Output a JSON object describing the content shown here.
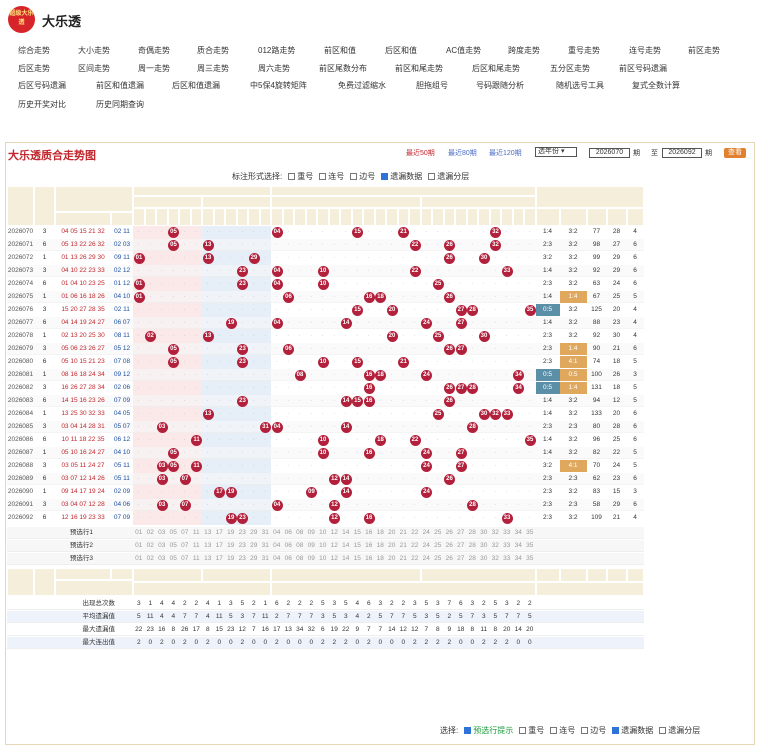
{
  "site": {
    "logo_text": "超级大乐透",
    "title": "大乐透"
  },
  "nav": [
    [
      "综合走势",
      "大小走势",
      "奇偶走势",
      "质合走势",
      "012路走势",
      "前区和值",
      "后区和值",
      "AC值走势",
      "跨度走势",
      "重号走势",
      "连号走势",
      "前区走势"
    ],
    [
      "后区走势",
      "区间走势",
      "周一走势",
      "周三走势",
      "周六走势",
      "前区尾数分布",
      "前区和尾走势",
      "后区和尾走势",
      "五分区走势",
      "前区号码遗漏"
    ],
    [
      "后区号码遗漏",
      "前区和值遗漏",
      "后区和值遗漏",
      "中5保4旋转矩阵",
      "免费过滤缩水",
      "胆拖组号",
      "号码跟随分析",
      "随机选号工具",
      "复式全数计算"
    ],
    [
      "历史开奖对比",
      "历史同期查询"
    ]
  ],
  "panel": {
    "title": "大乐透质合走势图",
    "recent": [
      "最近50期",
      "最近80期",
      "最近120期"
    ],
    "year_select": "选年份",
    "from": "2026070",
    "to": "2026092",
    "from_label": "期",
    "to_label": "至",
    "to_suffix": "期",
    "query_btn": "查看"
  },
  "options": {
    "label": "标注形式选择:",
    "items": [
      {
        "t": "重号",
        "on": false
      },
      {
        "t": "连号",
        "on": false
      },
      {
        "t": "边号",
        "on": false
      },
      {
        "t": "遗漏数据",
        "on": true
      },
      {
        "t": "遗漏分层",
        "on": false
      }
    ]
  },
  "headers": {
    "issue": "期号",
    "week": "星期",
    "draw": "开奖号码",
    "front": "前区",
    "back": "后区",
    "prime": "质数区",
    "prime_left": "质数左区",
    "prime_right": "质数右区",
    "comp": "合数区",
    "comp_left": "合数左区",
    "comp_right": "合数右区",
    "analysis": "前区分析",
    "an_cols": [
      "质合比",
      "奇偶比",
      "和值",
      "跨度",
      "AC值"
    ],
    "prime_nums": [
      "01",
      "02",
      "03",
      "05",
      "07",
      "11",
      "13",
      "17",
      "19",
      "23",
      "29",
      "31"
    ],
    "comp_nums": [
      "04",
      "06",
      "08",
      "09",
      "10",
      "12",
      "14",
      "15",
      "16",
      "18",
      "20",
      "21",
      "22",
      "24",
      "25",
      "26",
      "27",
      "28",
      "30",
      "32",
      "33",
      "34",
      "35"
    ]
  },
  "rows": [
    {
      "issue": "2026070",
      "week": "3",
      "f": "04 05 15 21 32",
      "b": "02 11",
      "balls": [
        "05",
        "04",
        "15",
        "21",
        "32"
      ],
      "qh": "1:4",
      "jo": "3:2",
      "sum": "77",
      "span": "28",
      "ac": "4"
    },
    {
      "issue": "2026071",
      "week": "6",
      "f": "05 13 22 26 32",
      "b": "02 03",
      "balls": [
        "05",
        "13",
        "22",
        "26",
        "32"
      ],
      "qh": "2:3",
      "jo": "3:2",
      "sum": "98",
      "span": "27",
      "ac": "6"
    },
    {
      "issue": "2026072",
      "week": "1",
      "f": "01 13 26 29 30",
      "b": "09 11",
      "balls": [
        "01",
        "13",
        "29",
        "26",
        "30"
      ],
      "qh": "3:2",
      "jo": "3:2",
      "sum": "99",
      "span": "29",
      "ac": "6"
    },
    {
      "issue": "2026073",
      "week": "3",
      "f": "04 10 22 23 33",
      "b": "02 12",
      "balls": [
        "23",
        "04",
        "10",
        "22",
        "33"
      ],
      "qh": "1:4",
      "jo": "3:2",
      "sum": "92",
      "span": "29",
      "ac": "6"
    },
    {
      "issue": "2026074",
      "week": "6",
      "f": "01 04 10 23 25",
      "b": "01 12",
      "balls": [
        "01",
        "23",
        "04",
        "10",
        "25"
      ],
      "qh": "2:3",
      "jo": "3:2",
      "sum": "63",
      "span": "24",
      "ac": "6"
    },
    {
      "issue": "2026075",
      "week": "1",
      "f": "01 06 16 18 26",
      "b": "04 10",
      "balls": [
        "01",
        "06",
        "16",
        "18",
        "26"
      ],
      "qh": "1:4",
      "jo": "1:4",
      "sum": "67",
      "span": "25",
      "ac": "5"
    },
    {
      "issue": "2026076",
      "week": "3",
      "f": "15 20 27 28 35",
      "b": "02 11",
      "balls": [
        "15",
        "20",
        "27",
        "28",
        "35"
      ],
      "qh": "0:5",
      "jo": "3:2",
      "sum": "125",
      "span": "20",
      "ac": "4"
    },
    {
      "issue": "2026077",
      "week": "6",
      "f": "04 14 19 24 27",
      "b": "06 07",
      "balls": [
        "19",
        "04",
        "14",
        "24",
        "27"
      ],
      "qh": "1:4",
      "jo": "3:2",
      "sum": "88",
      "span": "23",
      "ac": "4"
    },
    {
      "issue": "2026078",
      "week": "1",
      "f": "02 13 20 25 30",
      "b": "08 11",
      "balls": [
        "02",
        "13",
        "20",
        "25",
        "30"
      ],
      "qh": "2:3",
      "jo": "3:2",
      "sum": "92",
      "span": "30",
      "ac": "4"
    },
    {
      "issue": "2026079",
      "week": "3",
      "f": "05 06 23 26 27",
      "b": "05 12",
      "balls": [
        "05",
        "23",
        "06",
        "26",
        "27"
      ],
      "qh": "2:3",
      "jo": "1:4",
      "sum": "90",
      "span": "21",
      "ac": "6"
    },
    {
      "issue": "2026080",
      "week": "6",
      "f": "05 10 15 21 23",
      "b": "07 08",
      "balls": [
        "05",
        "23",
        "10",
        "15",
        "21"
      ],
      "qh": "2:3",
      "jo": "4:1",
      "sum": "74",
      "span": "18",
      "ac": "5"
    },
    {
      "issue": "2026081",
      "week": "1",
      "f": "08 16 18 24 34",
      "b": "09 12",
      "balls": [
        "08",
        "16",
        "18",
        "24",
        "34"
      ],
      "qh": "0:5",
      "jo": "0:5",
      "sum": "100",
      "span": "26",
      "ac": "3"
    },
    {
      "issue": "2026082",
      "week": "3",
      "f": "16 26 27 28 34",
      "b": "02 06",
      "balls": [
        "16",
        "26",
        "27",
        "28",
        "34"
      ],
      "qh": "0:5",
      "jo": "1:4",
      "sum": "131",
      "span": "18",
      "ac": "5"
    },
    {
      "issue": "2026083",
      "week": "6",
      "f": "14 15 16 23 26",
      "b": "07 09",
      "balls": [
        "23",
        "14",
        "15",
        "16",
        "26"
      ],
      "qh": "1:4",
      "jo": "3:2",
      "sum": "94",
      "span": "12",
      "ac": "5"
    },
    {
      "issue": "2026084",
      "week": "1",
      "f": "13 25 30 32 33",
      "b": "04 05",
      "balls": [
        "13",
        "25",
        "30",
        "32",
        "33"
      ],
      "qh": "1:4",
      "jo": "3:2",
      "sum": "133",
      "span": "20",
      "ac": "6"
    },
    {
      "issue": "2026085",
      "week": "3",
      "f": "03 04 14 28 31",
      "b": "05 07",
      "balls": [
        "03",
        "31",
        "04",
        "14",
        "28"
      ],
      "qh": "2:3",
      "jo": "2:3",
      "sum": "80",
      "span": "28",
      "ac": "6"
    },
    {
      "issue": "2026086",
      "week": "6",
      "f": "10 11 18 22 35",
      "b": "06 12",
      "balls": [
        "11",
        "10",
        "18",
        "22",
        "35"
      ],
      "qh": "1:4",
      "jo": "3:2",
      "sum": "96",
      "span": "25",
      "ac": "6"
    },
    {
      "issue": "2026087",
      "week": "1",
      "f": "05 10 16 24 27",
      "b": "04 10",
      "balls": [
        "05",
        "10",
        "16",
        "24",
        "27"
      ],
      "qh": "1:4",
      "jo": "3:2",
      "sum": "82",
      "span": "22",
      "ac": "5"
    },
    {
      "issue": "2026088",
      "week": "3",
      "f": "03 05 11 24 27",
      "b": "05 11",
      "balls": [
        "03",
        "05",
        "11",
        "24",
        "27"
      ],
      "qh": "3:2",
      "jo": "4:1",
      "sum": "70",
      "span": "24",
      "ac": "5"
    },
    {
      "issue": "2026089",
      "week": "6",
      "f": "03 07 12 14 26",
      "b": "05 11",
      "balls": [
        "03",
        "07",
        "12",
        "14",
        "26"
      ],
      "qh": "2:3",
      "jo": "2:3",
      "sum": "62",
      "span": "23",
      "ac": "6"
    },
    {
      "issue": "2026090",
      "week": "1",
      "f": "09 14 17 19 24",
      "b": "02 09",
      "balls": [
        "17",
        "19",
        "09",
        "14",
        "24"
      ],
      "qh": "2:3",
      "jo": "3:2",
      "sum": "83",
      "span": "15",
      "ac": "3"
    },
    {
      "issue": "2026091",
      "week": "3",
      "f": "03 04 07 12 28",
      "b": "04 06",
      "balls": [
        "03",
        "07",
        "04",
        "12",
        "28"
      ],
      "qh": "2:3",
      "jo": "2:3",
      "sum": "58",
      "span": "29",
      "ac": "6"
    },
    {
      "issue": "2026092",
      "week": "6",
      "f": "12 16 19 23 33",
      "b": "07 09",
      "balls": [
        "19",
        "23",
        "12",
        "16",
        "33"
      ],
      "qh": "2:3",
      "jo": "3:2",
      "sum": "109",
      "span": "21",
      "ac": "4"
    }
  ],
  "predict": [
    "预选行1",
    "预选行2",
    "预选行3"
  ],
  "stats": [
    {
      "label": "出现总次数",
      "vals": "3 1 4 4 2 2 4 1 3 5 2 1 6 2 2 2 5 3 5 4 6 3 2 2 3 5 3 7 6 3 2 5 3 2 2"
    },
    {
      "label": "平均遗漏值",
      "vals": "5 11 4 4 7 7 4 11 5 3 7 11 2 7 7 7 3 5 3 4 2 5 7 7 5 3 5 2 5 7 3 5 7 7 5"
    },
    {
      "label": "最大遗漏值",
      "vals": "22 23 16 8 26 17 8 15 23 12 7 16 17 13 34 32 6 19 22 9 7 7 14 12 12 7 8 9 18 8 11 8 20 14 20"
    },
    {
      "label": "最大连出值",
      "vals": "2 0 2 0 2 0 2 0 0 2 0 0 2 0 0 0 2 2 2 0 2 0 0 0 2 2 2 2 0 0 2 2 2 0 0"
    }
  ],
  "bottom": {
    "label": "选择:",
    "items": [
      {
        "t": "预选行提示",
        "on": true,
        "green": true
      },
      {
        "t": "重号",
        "on": false
      },
      {
        "t": "连号",
        "on": false
      },
      {
        "t": "边号",
        "on": false
      },
      {
        "t": "遗漏数据",
        "on": true
      },
      {
        "t": "遗漏分层",
        "on": false
      }
    ]
  }
}
